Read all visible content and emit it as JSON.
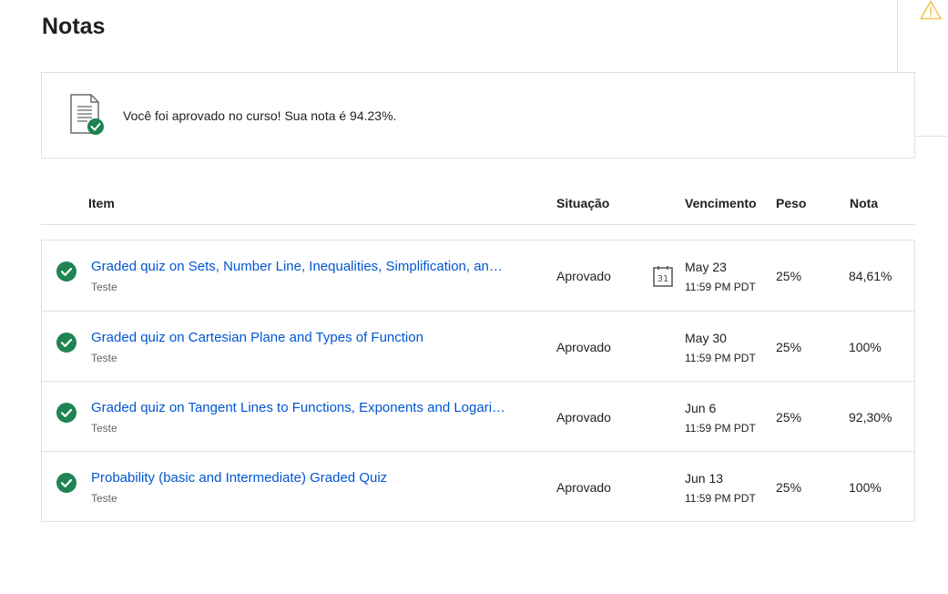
{
  "page_title": "Notas",
  "summary": {
    "icon": "document-check-icon",
    "text": "Você foi aprovado no curso! Sua nota é 94.23%."
  },
  "side_panel": {
    "icon": "warning-icon",
    "color": "#f5c451"
  },
  "colors": {
    "link": "#0056d2",
    "success": "#1f8354",
    "border": "#e1e1e1"
  },
  "table": {
    "headers": {
      "item": "Item",
      "status": "Situação",
      "due": "Vencimento",
      "weight": "Peso",
      "grade": "Nota"
    },
    "rows": [
      {
        "title": "Graded quiz on Sets, Number Line, Inequalities, Simplification, and Sigma Notation",
        "type": "Teste",
        "status": "Aprovado",
        "date": "May 23",
        "time": "11:59 PM PDT",
        "calendar_day": "31",
        "weight": "25%",
        "grade": "84,61%"
      },
      {
        "title": "Graded quiz on Cartesian Plane and Types of Function",
        "type": "Teste",
        "status": "Aprovado",
        "date": "May 30",
        "time": "11:59 PM PDT",
        "weight": "25%",
        "grade": "100%"
      },
      {
        "title": "Graded quiz on Tangent Lines to Functions, Exponents and Logarithms",
        "type": "Teste",
        "status": "Aprovado",
        "date": "Jun 6",
        "time": "11:59 PM PDT",
        "weight": "25%",
        "grade": "92,30%"
      },
      {
        "title": "Probability (basic and Intermediate) Graded Quiz",
        "type": "Teste",
        "status": "Aprovado",
        "date": "Jun 13",
        "time": "11:59 PM PDT",
        "weight": "25%",
        "grade": "100%"
      }
    ]
  }
}
